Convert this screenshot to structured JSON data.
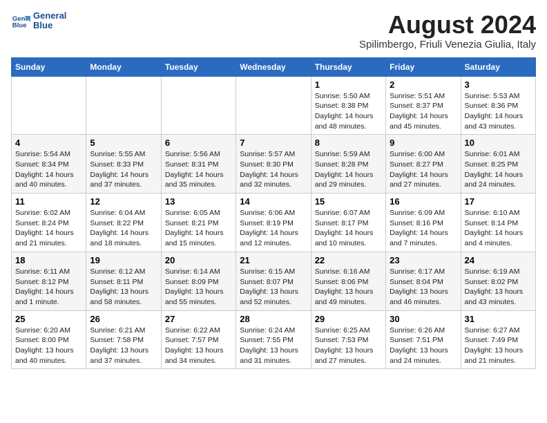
{
  "header": {
    "logo_line1": "General",
    "logo_line2": "Blue",
    "month_year": "August 2024",
    "location": "Spilimbergo, Friuli Venezia Giulia, Italy"
  },
  "weekdays": [
    "Sunday",
    "Monday",
    "Tuesday",
    "Wednesday",
    "Thursday",
    "Friday",
    "Saturday"
  ],
  "weeks": [
    [
      {
        "day": "",
        "info": ""
      },
      {
        "day": "",
        "info": ""
      },
      {
        "day": "",
        "info": ""
      },
      {
        "day": "",
        "info": ""
      },
      {
        "day": "1",
        "info": "Sunrise: 5:50 AM\nSunset: 8:38 PM\nDaylight: 14 hours\nand 48 minutes."
      },
      {
        "day": "2",
        "info": "Sunrise: 5:51 AM\nSunset: 8:37 PM\nDaylight: 14 hours\nand 45 minutes."
      },
      {
        "day": "3",
        "info": "Sunrise: 5:53 AM\nSunset: 8:36 PM\nDaylight: 14 hours\nand 43 minutes."
      }
    ],
    [
      {
        "day": "4",
        "info": "Sunrise: 5:54 AM\nSunset: 8:34 PM\nDaylight: 14 hours\nand 40 minutes."
      },
      {
        "day": "5",
        "info": "Sunrise: 5:55 AM\nSunset: 8:33 PM\nDaylight: 14 hours\nand 37 minutes."
      },
      {
        "day": "6",
        "info": "Sunrise: 5:56 AM\nSunset: 8:31 PM\nDaylight: 14 hours\nand 35 minutes."
      },
      {
        "day": "7",
        "info": "Sunrise: 5:57 AM\nSunset: 8:30 PM\nDaylight: 14 hours\nand 32 minutes."
      },
      {
        "day": "8",
        "info": "Sunrise: 5:59 AM\nSunset: 8:28 PM\nDaylight: 14 hours\nand 29 minutes."
      },
      {
        "day": "9",
        "info": "Sunrise: 6:00 AM\nSunset: 8:27 PM\nDaylight: 14 hours\nand 27 minutes."
      },
      {
        "day": "10",
        "info": "Sunrise: 6:01 AM\nSunset: 8:25 PM\nDaylight: 14 hours\nand 24 minutes."
      }
    ],
    [
      {
        "day": "11",
        "info": "Sunrise: 6:02 AM\nSunset: 8:24 PM\nDaylight: 14 hours\nand 21 minutes."
      },
      {
        "day": "12",
        "info": "Sunrise: 6:04 AM\nSunset: 8:22 PM\nDaylight: 14 hours\nand 18 minutes."
      },
      {
        "day": "13",
        "info": "Sunrise: 6:05 AM\nSunset: 8:21 PM\nDaylight: 14 hours\nand 15 minutes."
      },
      {
        "day": "14",
        "info": "Sunrise: 6:06 AM\nSunset: 8:19 PM\nDaylight: 14 hours\nand 12 minutes."
      },
      {
        "day": "15",
        "info": "Sunrise: 6:07 AM\nSunset: 8:17 PM\nDaylight: 14 hours\nand 10 minutes."
      },
      {
        "day": "16",
        "info": "Sunrise: 6:09 AM\nSunset: 8:16 PM\nDaylight: 14 hours\nand 7 minutes."
      },
      {
        "day": "17",
        "info": "Sunrise: 6:10 AM\nSunset: 8:14 PM\nDaylight: 14 hours\nand 4 minutes."
      }
    ],
    [
      {
        "day": "18",
        "info": "Sunrise: 6:11 AM\nSunset: 8:12 PM\nDaylight: 14 hours\nand 1 minute."
      },
      {
        "day": "19",
        "info": "Sunrise: 6:12 AM\nSunset: 8:11 PM\nDaylight: 13 hours\nand 58 minutes."
      },
      {
        "day": "20",
        "info": "Sunrise: 6:14 AM\nSunset: 8:09 PM\nDaylight: 13 hours\nand 55 minutes."
      },
      {
        "day": "21",
        "info": "Sunrise: 6:15 AM\nSunset: 8:07 PM\nDaylight: 13 hours\nand 52 minutes."
      },
      {
        "day": "22",
        "info": "Sunrise: 6:16 AM\nSunset: 8:06 PM\nDaylight: 13 hours\nand 49 minutes."
      },
      {
        "day": "23",
        "info": "Sunrise: 6:17 AM\nSunset: 8:04 PM\nDaylight: 13 hours\nand 46 minutes."
      },
      {
        "day": "24",
        "info": "Sunrise: 6:19 AM\nSunset: 8:02 PM\nDaylight: 13 hours\nand 43 minutes."
      }
    ],
    [
      {
        "day": "25",
        "info": "Sunrise: 6:20 AM\nSunset: 8:00 PM\nDaylight: 13 hours\nand 40 minutes."
      },
      {
        "day": "26",
        "info": "Sunrise: 6:21 AM\nSunset: 7:58 PM\nDaylight: 13 hours\nand 37 minutes."
      },
      {
        "day": "27",
        "info": "Sunrise: 6:22 AM\nSunset: 7:57 PM\nDaylight: 13 hours\nand 34 minutes."
      },
      {
        "day": "28",
        "info": "Sunrise: 6:24 AM\nSunset: 7:55 PM\nDaylight: 13 hours\nand 31 minutes."
      },
      {
        "day": "29",
        "info": "Sunrise: 6:25 AM\nSunset: 7:53 PM\nDaylight: 13 hours\nand 27 minutes."
      },
      {
        "day": "30",
        "info": "Sunrise: 6:26 AM\nSunset: 7:51 PM\nDaylight: 13 hours\nand 24 minutes."
      },
      {
        "day": "31",
        "info": "Sunrise: 6:27 AM\nSunset: 7:49 PM\nDaylight: 13 hours\nand 21 minutes."
      }
    ]
  ]
}
